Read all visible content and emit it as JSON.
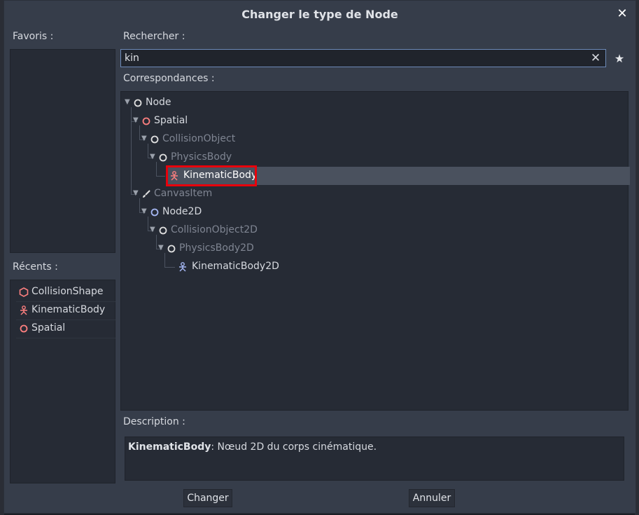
{
  "dialog": {
    "title": "Changer le type de Node",
    "close_icon": "close-icon"
  },
  "favorites": {
    "label": "Favoris :"
  },
  "recents": {
    "label": "Récents :",
    "items": [
      {
        "label": "CollisionShape",
        "icon": "collision-shape-icon"
      },
      {
        "label": "KinematicBody",
        "icon": "kinematic-body-icon"
      },
      {
        "label": "Spatial",
        "icon": "spatial-icon"
      }
    ]
  },
  "search": {
    "label": "Rechercher :",
    "value": "kin",
    "clear_icon": "clear-icon",
    "favorite_icon": "star-icon"
  },
  "matches": {
    "label": "Correspondances :",
    "tree": [
      {
        "label": "Node",
        "dim": false,
        "icon": "node-icon"
      },
      {
        "label": "Spatial",
        "dim": false,
        "icon": "spatial-icon"
      },
      {
        "label": "CollisionObject",
        "dim": true,
        "icon": "node-icon"
      },
      {
        "label": "PhysicsBody",
        "dim": true,
        "icon": "node-icon"
      },
      {
        "label": "KinematicBody",
        "dim": false,
        "icon": "kinematic-body-icon",
        "selected": true
      },
      {
        "label": "CanvasItem",
        "dim": true,
        "icon": "brush-icon"
      },
      {
        "label": "Node2D",
        "dim": false,
        "icon": "node2d-icon"
      },
      {
        "label": "CollisionObject2D",
        "dim": true,
        "icon": "node-icon"
      },
      {
        "label": "PhysicsBody2D",
        "dim": true,
        "icon": "node-icon"
      },
      {
        "label": "KinematicBody2D",
        "dim": false,
        "icon": "kinematic-body-2d-icon"
      }
    ]
  },
  "description": {
    "label": "Description :",
    "class_name": "KinematicBody",
    "text": ": Nœud 2D du corps cinématique."
  },
  "buttons": {
    "change": "Changer",
    "cancel": "Annuler"
  },
  "colors": {
    "accent": "#6d8ab8",
    "spatial": "#fc7f7f",
    "node2d": "#a5b7f3",
    "selection": "#4a515e",
    "highlight": "#e8000b"
  }
}
